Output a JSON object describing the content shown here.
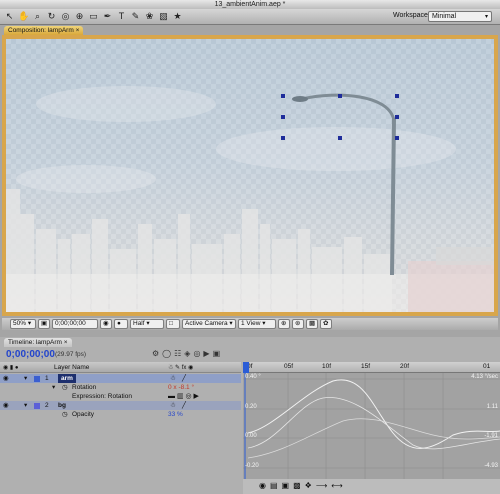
{
  "window": {
    "title": "13_ambientAnim.aep *"
  },
  "toolbar": {
    "tools": [
      {
        "name": "selection-tool",
        "glyph": "↖"
      },
      {
        "name": "hand-tool",
        "glyph": "✋"
      },
      {
        "name": "zoom-tool",
        "glyph": "⌕"
      },
      {
        "name": "rotate-tool",
        "glyph": "↻"
      },
      {
        "name": "orbit-camera-tool",
        "glyph": "◎"
      },
      {
        "name": "pan-behind-tool",
        "glyph": "⊕"
      },
      {
        "name": "rectangle-mask-tool",
        "glyph": "▭"
      },
      {
        "name": "pen-tool",
        "glyph": "✒"
      },
      {
        "name": "type-tool",
        "glyph": "T"
      },
      {
        "name": "brush-tool",
        "glyph": "✎"
      },
      {
        "name": "clone-stamp-tool",
        "glyph": "❀"
      },
      {
        "name": "eraser-tool",
        "glyph": "▧"
      },
      {
        "name": "puppet-tool",
        "glyph": "★"
      }
    ],
    "workspace_label": "Workspace:",
    "workspace_value": "Minimal"
  },
  "composition": {
    "tab_label": "Composition: lampArm",
    "zoom": "50%",
    "timecode": "0;00;00;00",
    "resolution": "Half",
    "camera": "Active Camera",
    "view": "1 View"
  },
  "timeline": {
    "tab_label": "Timeline: lampArm",
    "current_time": "0;00;00;00",
    "fps": "(29.97 fps)",
    "header_layer_name": "Layer Name",
    "layers": [
      {
        "num": "1",
        "name": "arm",
        "color": "#3b5fd0",
        "selected": true
      },
      {
        "num": "2",
        "name": "bg",
        "color": "#5b5fd8",
        "selected": false
      }
    ],
    "properties": [
      {
        "label": "Rotation",
        "value": "0 x -8.1 °"
      },
      {
        "label": "Expression: Rotation",
        "value": ""
      },
      {
        "label": "Opacity",
        "value": "33 %"
      }
    ]
  },
  "graph": {
    "ruler_labels": [
      "0f",
      "05f",
      "10f",
      "15f",
      "20f",
      "01"
    ],
    "left_labels": [
      "0.40 °",
      "0.20",
      "0.00",
      "-0.20"
    ],
    "right_labels": [
      "4.13 °/sec",
      "1.11",
      "-1.91",
      "-4.93"
    ]
  }
}
